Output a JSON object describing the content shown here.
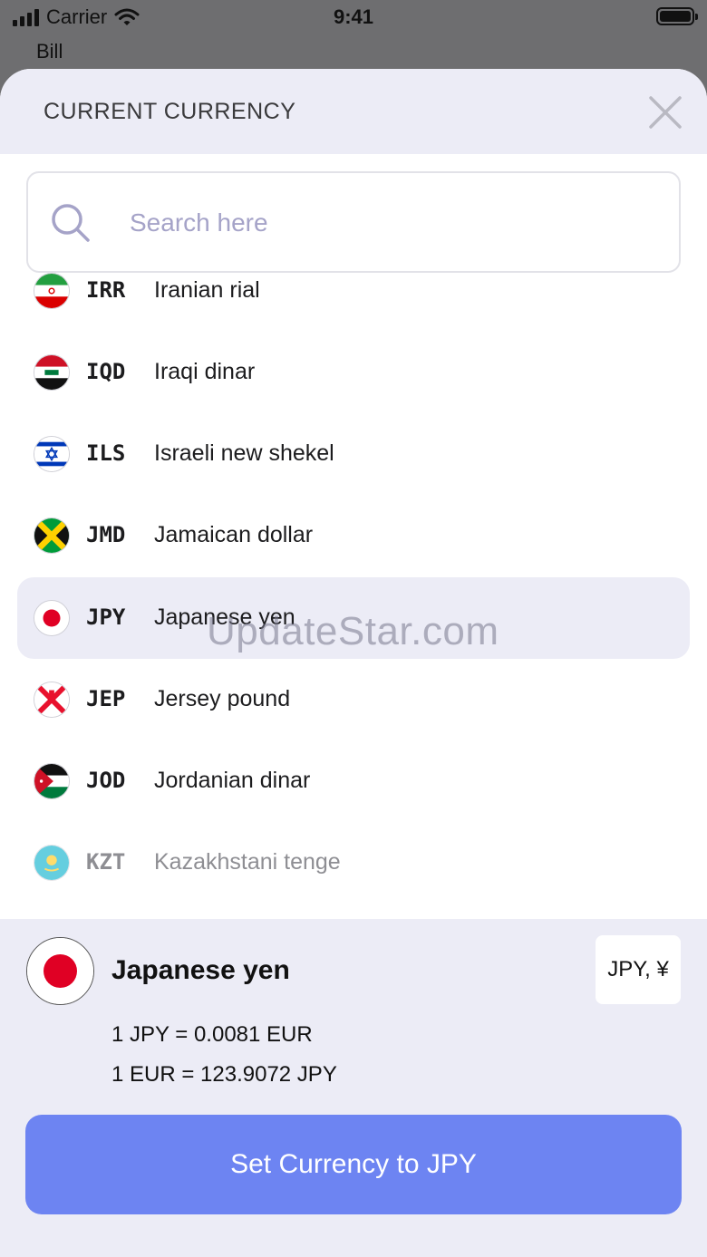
{
  "status_bar": {
    "carrier": "Carrier",
    "time": "9:41",
    "back_label": "Bill"
  },
  "sheet": {
    "title": "CURRENT CURRENCY",
    "search": {
      "placeholder": "Search here",
      "value": ""
    }
  },
  "currencies": [
    {
      "code": "IRR",
      "name": "Iranian rial",
      "flag": "iran-flag-icon"
    },
    {
      "code": "IQD",
      "name": "Iraqi dinar",
      "flag": "iraq-flag-icon"
    },
    {
      "code": "ILS",
      "name": "Israeli new shekel",
      "flag": "israel-flag-icon"
    },
    {
      "code": "JMD",
      "name": "Jamaican dollar",
      "flag": "jamaica-flag-icon"
    },
    {
      "code": "JPY",
      "name": "Japanese yen",
      "flag": "japan-flag-icon",
      "selected": true
    },
    {
      "code": "JEP",
      "name": "Jersey pound",
      "flag": "jersey-flag-icon"
    },
    {
      "code": "JOD",
      "name": "Jordanian dinar",
      "flag": "jordan-flag-icon"
    },
    {
      "code": "KZT",
      "name": "Kazakhstani tenge",
      "flag": "kazakhstan-flag-icon"
    }
  ],
  "watermark": "UpdateStar.com",
  "selection": {
    "name": "Japanese yen",
    "symbol": "JPY, ¥",
    "rate_1": "1 JPY = 0.0081 EUR",
    "rate_2": "1 EUR = 123.9072 JPY",
    "button_label": "Set Currency to JPY"
  },
  "colors": {
    "accent": "#6d84f2",
    "header_bg": "#ececf6",
    "placeholder": "#a5a3c8"
  }
}
